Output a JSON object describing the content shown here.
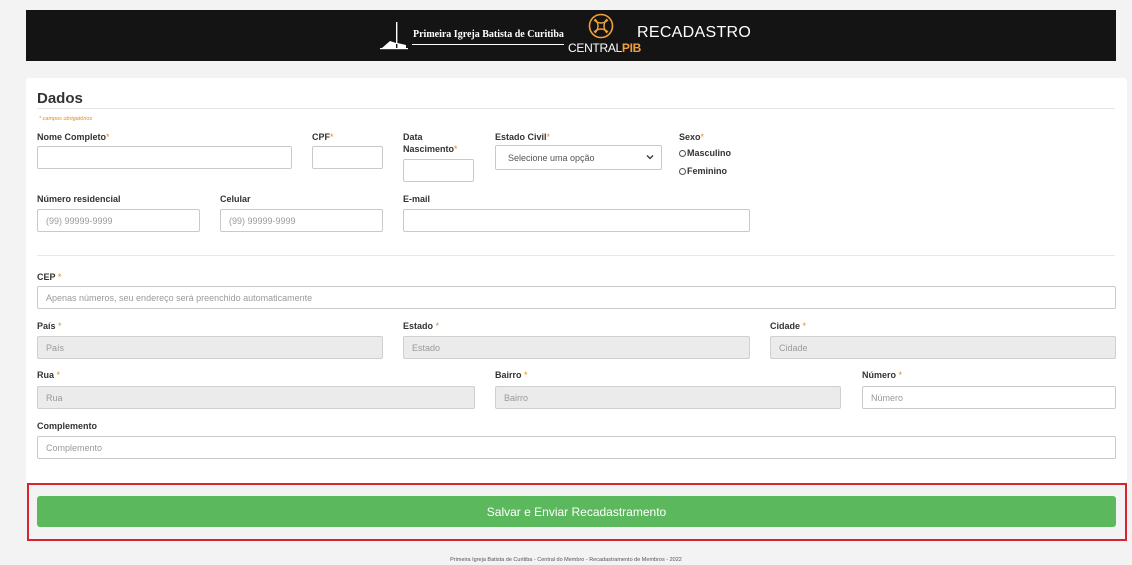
{
  "header": {
    "church_name": "Primeira Igreja Batista de Curitiba",
    "central_prefix": "CENTRAL",
    "central_suffix": "PIB",
    "title": "RECADASTRO"
  },
  "form": {
    "section_title": "Dados",
    "required_note": "* campos obrigatórios",
    "required_mark": "*",
    "nome": {
      "label": "Nome Completo",
      "value": "",
      "placeholder": ""
    },
    "cpf": {
      "label": "CPF",
      "value": "",
      "placeholder": ""
    },
    "nascimento": {
      "label_line1": "Data",
      "label_line2": "Nascimento",
      "value": ""
    },
    "estado_civil": {
      "label": "Estado Civil",
      "selected": "Selecione uma opção"
    },
    "sexo": {
      "label": "Sexo",
      "options": [
        "Masculino",
        "Feminino"
      ]
    },
    "numero_residencial": {
      "label": "Número residencial",
      "placeholder": "(99) 99999-9999"
    },
    "celular": {
      "label": "Celular",
      "placeholder": "(99) 99999-9999"
    },
    "email": {
      "label": "E-mail",
      "placeholder": ""
    },
    "cep": {
      "label": "CEP",
      "placeholder": "Apenas números, seu endereço será preenchido automaticamente"
    },
    "pais": {
      "label": "País",
      "placeholder": "País"
    },
    "estado": {
      "label": "Estado",
      "placeholder": "Estado"
    },
    "cidade": {
      "label": "Cidade",
      "placeholder": "Cidade"
    },
    "rua": {
      "label": "Rua",
      "placeholder": "Rua"
    },
    "bairro": {
      "label": "Bairro",
      "placeholder": "Bairro"
    },
    "numero": {
      "label": "Número",
      "placeholder": "Número"
    },
    "complemento": {
      "label": "Complemento",
      "placeholder": "Complemento"
    },
    "submit_label": "Salvar e Enviar Recadastramento"
  },
  "footer": {
    "text": "Primeira Igreja Batista de Curitiba - Central do Membro - Recadastramento de Membros - 2022"
  },
  "colors": {
    "header_bg": "#141414",
    "accent_orange": "#e48a1d",
    "button_green": "#5cb85c",
    "highlight_red": "#d9232e"
  }
}
